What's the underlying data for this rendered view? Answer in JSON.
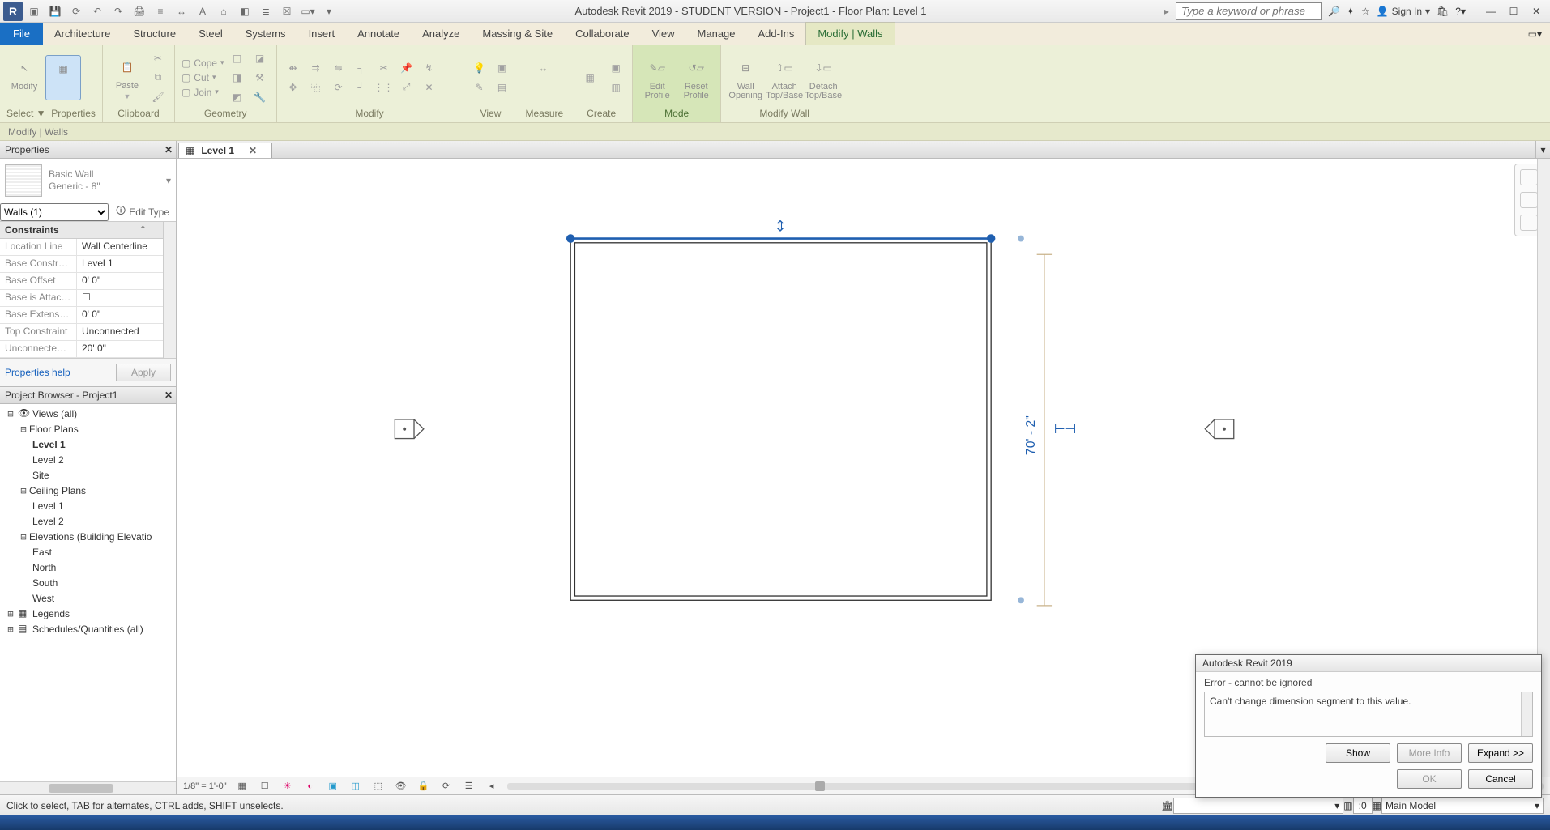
{
  "title": "Autodesk Revit 2019 - STUDENT VERSION - Project1 - Floor Plan: Level 1",
  "search_placeholder": "Type a keyword or phrase",
  "signin": "Sign In",
  "ribbon_tabs": {
    "file": "File",
    "tabs": [
      "Architecture",
      "Structure",
      "Steel",
      "Systems",
      "Insert",
      "Annotate",
      "Analyze",
      "Massing & Site",
      "Collaborate",
      "View",
      "Manage",
      "Add-Ins",
      "Modify | Walls"
    ],
    "active": "Modify | Walls"
  },
  "panels": {
    "select": {
      "label": "Select ▼",
      "modify": "Modify",
      "properties": "Properties"
    },
    "clipboard": {
      "label": "Clipboard",
      "paste": "Paste",
      "cope": "Cope",
      "cut": "Cut",
      "join": "Join"
    },
    "geometry": {
      "label": "Geometry"
    },
    "modify": {
      "label": "Modify"
    },
    "view": {
      "label": "View"
    },
    "measure": {
      "label": "Measure"
    },
    "create": {
      "label": "Create"
    },
    "mode": {
      "label": "Mode",
      "editp": "Edit Profile",
      "resetp": "Reset Profile"
    },
    "mwall": {
      "label": "Modify Wall",
      "wopen": "Wall Opening",
      "attach": "Attach Top/Base",
      "detach": "Detach Top/Base"
    }
  },
  "optbar": "Modify | Walls",
  "viewtab": "Level 1",
  "properties": {
    "title": "Properties",
    "wtype1": "Basic Wall",
    "wtype2": "Generic - 8\"",
    "cat": "Walls (1)",
    "edit_type": "Edit Type",
    "group": "Constraints",
    "rows": [
      {
        "k": "Location Line",
        "v": "Wall Centerline"
      },
      {
        "k": "Base Constraint",
        "v": "Level 1"
      },
      {
        "k": "Base Offset",
        "v": "0'  0\""
      },
      {
        "k": "Base is Attach...",
        "v": ""
      },
      {
        "k": "Base Extensio...",
        "v": "0'  0\""
      },
      {
        "k": "Top Constraint",
        "v": "Unconnected"
      },
      {
        "k": "Unconnected ...",
        "v": "20'  0\""
      }
    ],
    "help": "Properties help",
    "apply": "Apply"
  },
  "browser": {
    "title": "Project Browser - Project1",
    "views_all": "Views (all)",
    "floor_plans": "Floor Plans",
    "fp": [
      "Level 1",
      "Level 2",
      "Site"
    ],
    "ceiling_plans": "Ceiling Plans",
    "cp": [
      "Level 1",
      "Level 2"
    ],
    "elev": "Elevations (Building Elevatio",
    "el": [
      "East",
      "North",
      "South",
      "West"
    ],
    "legends": "Legends",
    "sched": "Schedules/Quantities (all)"
  },
  "viewctrl": {
    "scale": "1/8\" = 1'-0\""
  },
  "dim": "70' - 2\"",
  "status": {
    "msg": "Click to select, TAB for alternates, CTRL adds, SHIFT unselects.",
    "zero": ":0",
    "model": "Main Model"
  },
  "dialog": {
    "title": "Autodesk Revit 2019",
    "err": "Error - cannot be ignored",
    "msg": "Can't change dimension segment to this value.",
    "show": "Show",
    "more": "More Info",
    "expand": "Expand >>",
    "ok": "OK",
    "cancel": "Cancel"
  }
}
